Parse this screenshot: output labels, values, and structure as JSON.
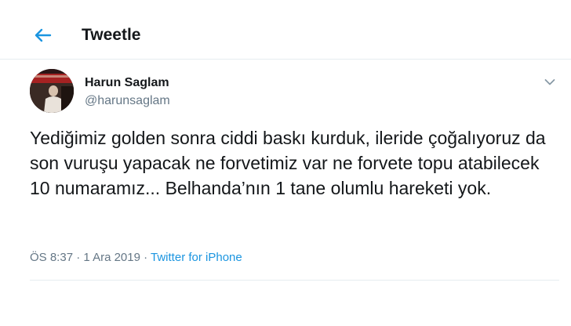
{
  "header": {
    "title": "Tweetle",
    "back_icon": "arrow-left-icon"
  },
  "author": {
    "name": "Harun Saglam",
    "handle": "@harunsaglam"
  },
  "tweet": {
    "text": "Yediğimiz golden sonra ciddi baskı kurduk, ileride çoğalıyoruz da son vuruşu yapacak ne forvetimiz var ne forvete topu atabilecek 10 numaramız... Belhanda’nın 1 tane olumlu hareketi yok.",
    "time": "ÖS 8:37",
    "date": "1 Ara 2019",
    "separator": " · ",
    "source": "Twitter for iPhone"
  },
  "colors": {
    "accent": "#1b95e0",
    "secondary_text": "#657786",
    "divider": "#e6ecf0"
  }
}
